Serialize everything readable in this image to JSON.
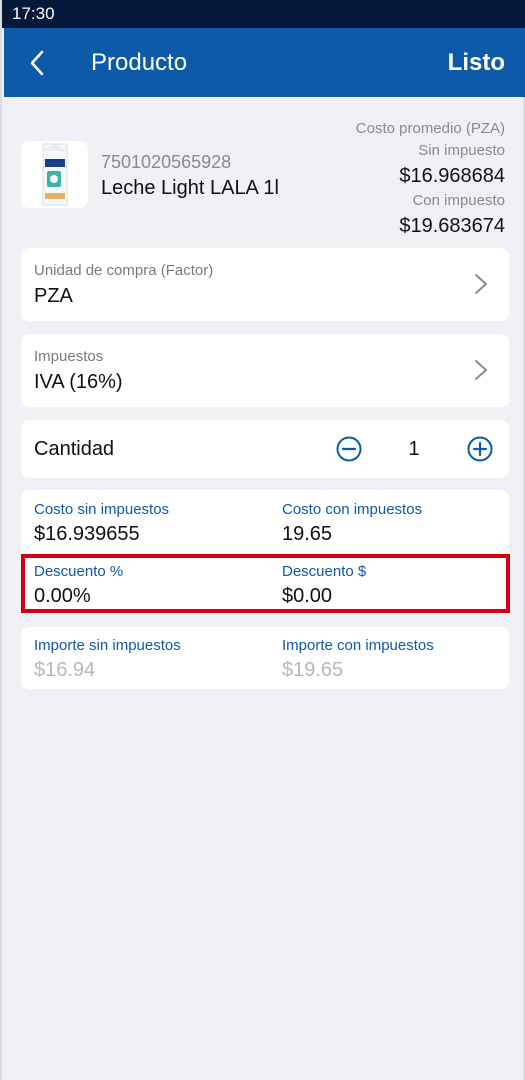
{
  "status_bar": {
    "time": "17:30"
  },
  "header": {
    "title": "Producto",
    "done_label": "Listo"
  },
  "product": {
    "barcode": "7501020565928",
    "name": "Leche Light LALA 1l",
    "image_brand": "LALA",
    "cost": {
      "title": "Costo promedio (PZA)",
      "without_tax_label": "Sin impuesto",
      "without_tax_value": "$16.968684",
      "with_tax_label": "Con impuesto",
      "with_tax_value": "$19.683674"
    }
  },
  "purchase_unit": {
    "label": "Unidad de compra (Factor)",
    "value": "PZA"
  },
  "taxes": {
    "label": "Impuestos",
    "value": "IVA (16%)"
  },
  "quantity": {
    "label": "Cantidad",
    "value": "1"
  },
  "costs": {
    "cost_without_tax_label": "Costo sin impuestos",
    "cost_without_tax_value": "$16.939655",
    "cost_with_tax_label": "Costo con impuestos",
    "cost_with_tax_value": "19.65",
    "discount_pct_label": "Descuento %",
    "discount_pct_value": "0.00%",
    "discount_amt_label": "Descuento $",
    "discount_amt_value": "$0.00"
  },
  "amounts": {
    "amount_without_tax_label": "Importe sin impuestos",
    "amount_without_tax_value": "$16.94",
    "amount_with_tax_label": "Importe con impuestos",
    "amount_with_tax_value": "$19.65"
  },
  "colors": {
    "app_bar": "#0d5aa8",
    "status_bar": "#03183a",
    "label_blue": "#0d5aa8",
    "highlight_red": "#d00012"
  },
  "icons": [
    "back-arrow-icon",
    "chevron-right-icon",
    "minus-circle-icon",
    "plus-circle-icon"
  ]
}
